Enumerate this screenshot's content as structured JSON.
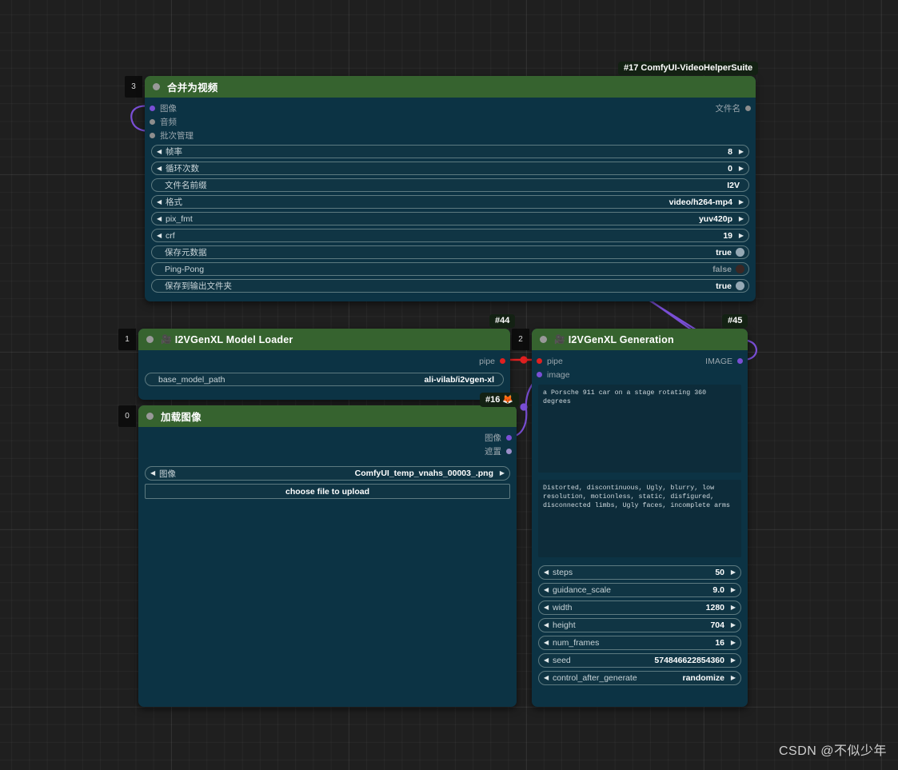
{
  "canvas": {
    "background_color": "#1f1f1f",
    "node_header_color": "#36632f",
    "node_body_color": "#0c3344",
    "wire_color_image": "#7a4fd6",
    "wire_color_pipe": "#e02020"
  },
  "watermark": {
    "text": "CSDN @不似少年"
  },
  "nodes": [
    {
      "id_tab": "3",
      "badge": "#17 ComfyUI-VideoHelperSuite",
      "title": "合并为视频",
      "title_emoji": "",
      "inputs": [
        {
          "label": "图像",
          "color": "#7a4fd6"
        },
        {
          "label": "音频",
          "color": "#8d8d8d"
        },
        {
          "label": "批次管理",
          "color": "#8d8d8d"
        }
      ],
      "outputs": [
        {
          "label": "文件名",
          "color": "#8d8d8d"
        }
      ],
      "widgets": [
        {
          "type": "number",
          "name": "帧率",
          "value": "8"
        },
        {
          "type": "number",
          "name": "循环次数",
          "value": "0"
        },
        {
          "type": "text",
          "name": "文件名前缀",
          "value": "I2V"
        },
        {
          "type": "combo",
          "name": "格式",
          "value": "video/h264-mp4"
        },
        {
          "type": "combo",
          "name": "pix_fmt",
          "value": "yuv420p"
        },
        {
          "type": "number",
          "name": "crf",
          "value": "19"
        },
        {
          "type": "toggle",
          "name": "保存元数据",
          "value": "true",
          "on": true
        },
        {
          "type": "toggle",
          "name": "Ping-Pong",
          "value": "false",
          "on": false
        },
        {
          "type": "toggle",
          "name": "保存到输出文件夹",
          "value": "true",
          "on": true
        }
      ]
    },
    {
      "id_tab": "1",
      "badge": "#44",
      "title": "I2VGenXL Model Loader",
      "title_emoji": "🎥",
      "inputs": [],
      "outputs": [
        {
          "label": "pipe",
          "color": "#e02020"
        }
      ],
      "widgets": [
        {
          "type": "text",
          "name": "base_model_path",
          "value": "ali-vilab/i2vgen-xl"
        }
      ]
    },
    {
      "id_tab": "2",
      "badge": "#45",
      "title": "I2VGenXL Generation",
      "title_emoji": "🎥",
      "inputs": [
        {
          "label": "pipe",
          "color": "#e02020"
        },
        {
          "label": "image",
          "color": "#7a4fd6"
        }
      ],
      "outputs": [
        {
          "label": "IMAGE",
          "color": "#7a4fd6"
        }
      ],
      "prompt_positive": "a Porsche 911 car on a stage rotating 360 degrees",
      "prompt_negative": "Distorted, discontinuous, Ugly, blurry, low resolution, motionless, static, disfigured, disconnected limbs, Ugly faces, incomplete arms",
      "widgets": [
        {
          "type": "number",
          "name": "steps",
          "value": "50"
        },
        {
          "type": "number",
          "name": "guidance_scale",
          "value": "9.0"
        },
        {
          "type": "number",
          "name": "width",
          "value": "1280"
        },
        {
          "type": "number",
          "name": "height",
          "value": "704"
        },
        {
          "type": "number",
          "name": "num_frames",
          "value": "16"
        },
        {
          "type": "number",
          "name": "seed",
          "value": "574846622854360"
        },
        {
          "type": "combo",
          "name": "control_after_generate",
          "value": "randomize"
        }
      ]
    },
    {
      "id_tab": "0",
      "badge": "#16 🦊",
      "title": "加载图像",
      "title_emoji": "",
      "inputs": [],
      "outputs": [
        {
          "label": "图像",
          "color": "#7a4fd6"
        },
        {
          "label": "遮置",
          "color": "#9b8fc9"
        }
      ],
      "widgets": [
        {
          "type": "combo",
          "name": "图像",
          "value": "ComfyUI_temp_vnahs_00003_.png"
        },
        {
          "type": "button",
          "name": "choose file to upload",
          "value": ""
        }
      ]
    }
  ]
}
